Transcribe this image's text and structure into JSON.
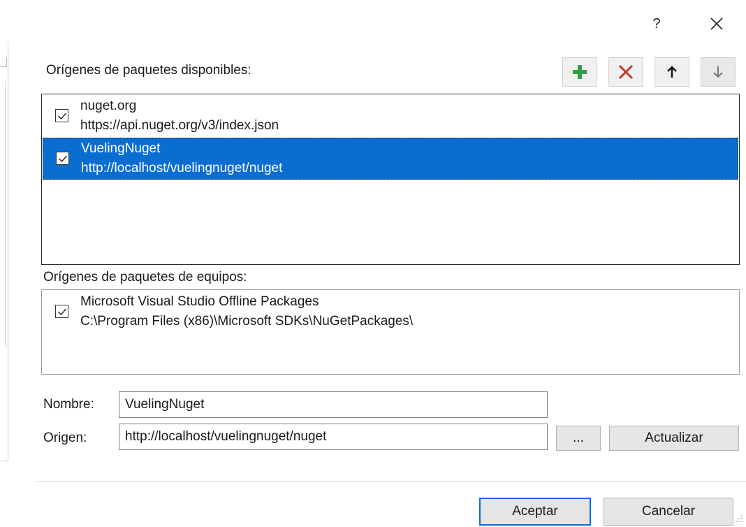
{
  "titlebar": {
    "help_label": "?",
    "close_icon": "close-icon"
  },
  "available": {
    "label": "Orígenes de paquetes disponibles:",
    "toolbar": {
      "add_icon": "plus-icon",
      "remove_icon": "delete-x-icon",
      "up_icon": "arrow-up-icon",
      "down_icon": "arrow-down-icon"
    },
    "sources": [
      {
        "name": "nuget.org",
        "url": "https://api.nuget.org/v3/index.json",
        "checked": true,
        "selected": false
      },
      {
        "name": "VuelingNuget",
        "url": "http://localhost/vuelingnuget/nuget",
        "checked": true,
        "selected": true
      }
    ]
  },
  "machine": {
    "label": "Orígenes de paquetes de equipos:",
    "sources": [
      {
        "name": "Microsoft Visual Studio Offline Packages",
        "url": "C:\\Program Files (x86)\\Microsoft SDKs\\NuGetPackages\\",
        "checked": true
      }
    ]
  },
  "form": {
    "name_label": "Nombre:",
    "name_value": "VuelingNuget",
    "source_label": "Origen:",
    "source_value": "http://localhost/vuelingnuget/nuget",
    "browse_label": "...",
    "update_label": "Actualizar"
  },
  "footer": {
    "ok_label": "Aceptar",
    "cancel_label": "Cancelar"
  },
  "colors": {
    "selection": "#0a6ed1",
    "add_green": "#2ea043",
    "remove_red": "#c0392b"
  }
}
